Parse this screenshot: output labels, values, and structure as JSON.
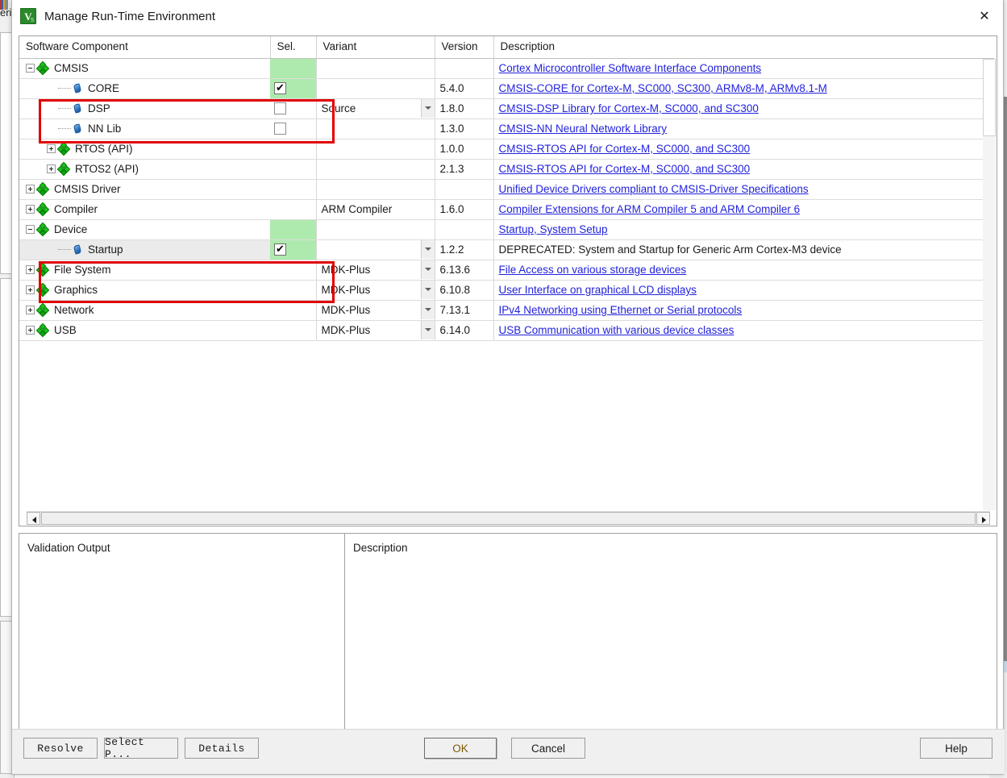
{
  "background": {
    "left_label": "eri"
  },
  "window": {
    "title": "Manage Run-Time Environment",
    "app_icon": "uvision-icon",
    "app_icon_glyph": "V",
    "app_icon_sub": "5",
    "close_label": "✕"
  },
  "table": {
    "headers": {
      "component": "Software Component",
      "sel": "Sel.",
      "variant": "Variant",
      "version": "Version",
      "description": "Description"
    },
    "rows": [
      {
        "name": "CMSIS",
        "level": 0,
        "icon": "bundle-icon",
        "expander": "minus",
        "sel": "green-none",
        "checked": false,
        "variant": "",
        "has_variant_arrow": false,
        "version": "",
        "description": "Cortex Microcontroller Software Interface Components",
        "desc_link": true,
        "highlight": false
      },
      {
        "name": "CORE",
        "level": 1,
        "icon": "component-icon",
        "expander": "none",
        "sel": "green-check",
        "checked": true,
        "variant": "",
        "has_variant_arrow": false,
        "version": "5.4.0",
        "description": "CMSIS-CORE for Cortex-M, SC000, SC300, ARMv8-M, ARMv8.1-M",
        "desc_link": true,
        "highlight": false
      },
      {
        "name": "DSP",
        "level": 1,
        "icon": "component-icon",
        "expander": "none",
        "sel": "empty-check",
        "checked": false,
        "variant": "Source",
        "has_variant_arrow": true,
        "version": "1.8.0",
        "description": "CMSIS-DSP Library for Cortex-M, SC000, and SC300",
        "desc_link": true,
        "highlight": false
      },
      {
        "name": "NN Lib",
        "level": 1,
        "icon": "component-icon",
        "expander": "none",
        "sel": "empty-check",
        "checked": false,
        "variant": "",
        "has_variant_arrow": false,
        "version": "1.3.0",
        "description": "CMSIS-NN Neural Network Library",
        "desc_link": true,
        "highlight": false
      },
      {
        "name": "RTOS (API)",
        "level": 1,
        "icon": "bundle-icon",
        "expander": "plus",
        "sel": "none",
        "checked": false,
        "variant": "",
        "has_variant_arrow": false,
        "version": "1.0.0",
        "description": "CMSIS-RTOS API for Cortex-M, SC000, and SC300",
        "desc_link": true,
        "highlight": false
      },
      {
        "name": "RTOS2 (API)",
        "level": 1,
        "icon": "bundle-icon",
        "expander": "plus",
        "sel": "none",
        "checked": false,
        "variant": "",
        "has_variant_arrow": false,
        "version": "2.1.3",
        "description": "CMSIS-RTOS API for Cortex-M, SC000, and SC300",
        "desc_link": true,
        "highlight": false
      },
      {
        "name": "CMSIS Driver",
        "level": 0,
        "icon": "bundle-icon",
        "expander": "plus",
        "sel": "none",
        "checked": false,
        "variant": "",
        "has_variant_arrow": false,
        "version": "",
        "description": "Unified Device Drivers compliant to CMSIS-Driver Specifications",
        "desc_link": true,
        "highlight": false
      },
      {
        "name": "Compiler",
        "level": 0,
        "icon": "bundle-icon",
        "expander": "plus",
        "sel": "none",
        "checked": false,
        "variant": "ARM Compiler",
        "has_variant_arrow": false,
        "version": "1.6.0",
        "description": "Compiler Extensions for ARM Compiler 5 and ARM Compiler 6",
        "desc_link": true,
        "highlight": false
      },
      {
        "name": "Device",
        "level": 0,
        "icon": "bundle-icon",
        "expander": "minus",
        "sel": "green-none",
        "checked": false,
        "variant": "",
        "has_variant_arrow": false,
        "version": "",
        "description": "Startup, System Setup",
        "desc_link": true,
        "highlight": false
      },
      {
        "name": "Startup",
        "level": 1,
        "icon": "component-icon",
        "expander": "none",
        "sel": "green-check",
        "checked": true,
        "variant": "",
        "has_variant_arrow": true,
        "version": "1.2.2",
        "description": "DEPRECATED: System and Startup for Generic Arm Cortex-M3 device",
        "desc_link": false,
        "highlight": true
      },
      {
        "name": "File System",
        "level": 0,
        "icon": "bundle-icon",
        "expander": "plus",
        "sel": "none",
        "checked": false,
        "variant": "MDK-Plus",
        "has_variant_arrow": true,
        "version": "6.13.6",
        "description": "File Access on various storage devices",
        "desc_link": true,
        "highlight": false
      },
      {
        "name": "Graphics",
        "level": 0,
        "icon": "bundle-icon",
        "expander": "plus",
        "sel": "none",
        "checked": false,
        "variant": "MDK-Plus",
        "has_variant_arrow": true,
        "version": "6.10.8",
        "description": "User Interface on graphical LCD displays",
        "desc_link": true,
        "highlight": false
      },
      {
        "name": "Network",
        "level": 0,
        "icon": "bundle-icon",
        "expander": "plus",
        "sel": "none",
        "checked": false,
        "variant": "MDK-Plus",
        "has_variant_arrow": true,
        "version": "7.13.1",
        "description": "IPv4 Networking using Ethernet or Serial protocols",
        "desc_link": true,
        "highlight": false
      },
      {
        "name": "USB",
        "level": 0,
        "icon": "bundle-icon",
        "expander": "plus",
        "sel": "none",
        "checked": false,
        "variant": "MDK-Plus",
        "has_variant_arrow": true,
        "version": "6.14.0",
        "description": "USB Communication with various device classes",
        "desc_link": true,
        "highlight": false
      }
    ]
  },
  "annotations": {
    "box_color": "#e00000",
    "box1_target": "CMSIS / CORE selection",
    "box2_target": "Device / Startup selection"
  },
  "bottom": {
    "validation_title": "Validation Output",
    "description_title": "Description",
    "validation_text": "",
    "description_text": ""
  },
  "footer": {
    "resolve": "Resolve",
    "select_p": "Select P...",
    "details": "Details",
    "ok": "OK",
    "cancel": "Cancel",
    "help": "Help"
  },
  "scrollbars": {
    "h_left_arrow": "◀",
    "h_right_arrow": "▶"
  }
}
